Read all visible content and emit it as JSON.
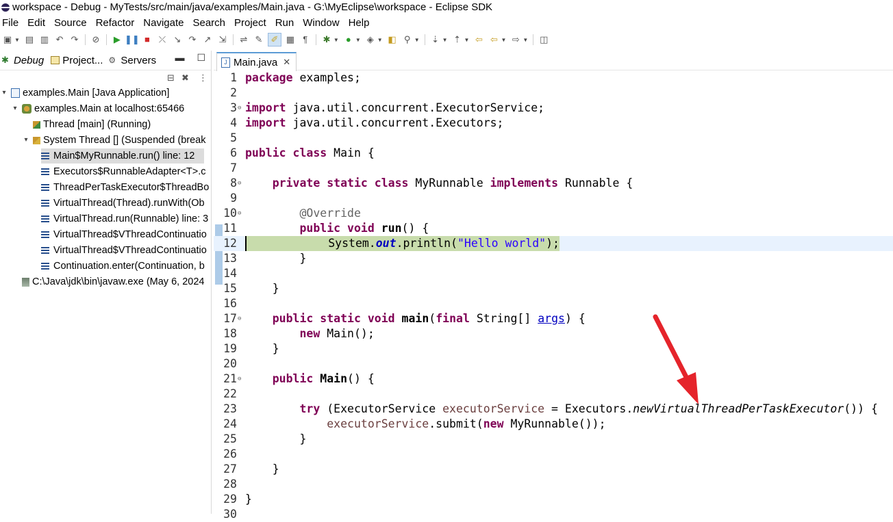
{
  "window": {
    "title": "workspace - Debug - MyTests/src/main/java/examples/Main.java - G:\\MyEclipse\\workspace - Eclipse SDK"
  },
  "menu": {
    "items": [
      "File",
      "Edit",
      "Source",
      "Refactor",
      "Navigate",
      "Search",
      "Project",
      "Run",
      "Window",
      "Help"
    ]
  },
  "toolbar": {
    "icons": [
      "new-icon",
      "save-icon",
      "save-all-icon",
      "undo-icon",
      "redo-icon",
      "skip-breakpoints-icon",
      "resume-icon",
      "suspend-icon",
      "terminate-icon",
      "disconnect-icon",
      "step-into-icon",
      "step-over-icon",
      "step-return-icon",
      "drop-to-frame-icon",
      "use-step-filters-icon",
      "toggle-mark-occurrences-icon",
      "toggle-highlight-icon",
      "block-selection-icon",
      "show-whitespace-icon",
      "debug-icon",
      "run-icon",
      "external-tools-icon",
      "open-type-icon",
      "search-icon",
      "next-annotation-icon",
      "prev-annotation-icon",
      "last-edit-icon",
      "back-icon",
      "forward-icon",
      "open-perspective-icon"
    ]
  },
  "debug_view": {
    "tabs": [
      {
        "label": "Debug",
        "active": true
      },
      {
        "label": "Project...",
        "active": false
      },
      {
        "label": "Servers",
        "active": false
      }
    ],
    "tree": [
      {
        "label": "examples.Main [Java Application]",
        "level": 0,
        "twisty": "▾",
        "icon": "java-launch-icon"
      },
      {
        "label": "examples.Main at localhost:65466",
        "level": 1,
        "twisty": "▾",
        "icon": "debug-target-icon"
      },
      {
        "label": "Thread [main] (Running)",
        "level": 2,
        "twisty": "",
        "icon": "thread-running-icon"
      },
      {
        "label": "System Thread [] (Suspended (break",
        "level": 2,
        "twisty": "▾",
        "icon": "thread-suspended-icon"
      },
      {
        "label": "Main$MyRunnable.run() line: 12",
        "level": 3,
        "twisty": "",
        "icon": "stack-frame-icon",
        "selected": true
      },
      {
        "label": "Executors$RunnableAdapter<T>.c",
        "level": 3,
        "twisty": "",
        "icon": "stack-frame-icon"
      },
      {
        "label": "ThreadPerTaskExecutor$ThreadBo",
        "level": 3,
        "twisty": "",
        "icon": "stack-frame-icon"
      },
      {
        "label": "VirtualThread(Thread).runWith(Ob",
        "level": 3,
        "twisty": "",
        "icon": "stack-frame-icon"
      },
      {
        "label": "VirtualThread.run(Runnable) line: 3",
        "level": 3,
        "twisty": "",
        "icon": "stack-frame-icon"
      },
      {
        "label": "VirtualThread$VThreadContinuatio",
        "level": 3,
        "twisty": "",
        "icon": "stack-frame-icon"
      },
      {
        "label": "VirtualThread$VThreadContinuatio",
        "level": 3,
        "twisty": "",
        "icon": "stack-frame-icon"
      },
      {
        "label": "Continuation.enter(Continuation, b",
        "level": 3,
        "twisty": "",
        "icon": "stack-frame-icon"
      },
      {
        "label": "C:\\Java\\jdk\\bin\\javaw.exe (May 6, 2024",
        "level": 1,
        "twisty": "",
        "icon": "process-icon"
      }
    ]
  },
  "editor": {
    "tab_label": "Main.java",
    "current_line": 12,
    "lines": [
      {
        "n": "1",
        "fold": "",
        "html": "<span class=\"kw\">package</span> examples;"
      },
      {
        "n": "2",
        "fold": "",
        "html": ""
      },
      {
        "n": "3",
        "fold": "⊖",
        "html": "<span class=\"kw\">import</span> java.util.concurrent.ExecutorService;"
      },
      {
        "n": "4",
        "fold": "",
        "html": "<span class=\"kw\">import</span> java.util.concurrent.Executors;"
      },
      {
        "n": "5",
        "fold": "",
        "html": ""
      },
      {
        "n": "6",
        "fold": "",
        "html": "<span class=\"kw\">public</span> <span class=\"kw\">class</span> Main {"
      },
      {
        "n": "7",
        "fold": "",
        "html": ""
      },
      {
        "n": "8",
        "fold": "⊖",
        "html": "    <span class=\"kw\">private</span> <span class=\"kw\">static</span> <span class=\"kw\">class</span> MyRunnable <span class=\"kw\">implements</span> Runnable {"
      },
      {
        "n": "9",
        "fold": "",
        "html": ""
      },
      {
        "n": "10",
        "fold": "⊖",
        "html": "        <span class=\"ann\">@Override</span>"
      },
      {
        "n": "11",
        "fold": "",
        "html": "        <span class=\"kw\">public</span> <span class=\"kw\">void</span> <b>run</b>() {"
      },
      {
        "n": "12",
        "fold": "",
        "html": "            System.<span class=\"field\">out</span>.println(<span class=\"str\">\"Hello world\"</span>);"
      },
      {
        "n": "13",
        "fold": "",
        "html": "        }"
      },
      {
        "n": "14",
        "fold": "",
        "html": ""
      },
      {
        "n": "15",
        "fold": "",
        "html": "    }"
      },
      {
        "n": "16",
        "fold": "",
        "html": ""
      },
      {
        "n": "17",
        "fold": "⊖",
        "html": "    <span class=\"kw\">public</span> <span class=\"kw\">static</span> <span class=\"kw\">void</span> <b>main</b>(<span class=\"kw\">final</span> String[] <span class=\"link\">args</span>) {"
      },
      {
        "n": "18",
        "fold": "",
        "html": "        <span class=\"kw\">new</span> Main();"
      },
      {
        "n": "19",
        "fold": "",
        "html": "    }"
      },
      {
        "n": "20",
        "fold": "",
        "html": ""
      },
      {
        "n": "21",
        "fold": "⊖",
        "html": "    <span class=\"kw\">public</span> <b>Main</b>() {"
      },
      {
        "n": "22",
        "fold": "",
        "html": ""
      },
      {
        "n": "23",
        "fold": "",
        "html": "        <span class=\"kw\">try</span> (ExecutorService <span class=\"var\">executorService</span> = Executors.<span class=\"ital\">newVirtualThreadPerTaskExecutor</span>()) {"
      },
      {
        "n": "24",
        "fold": "",
        "html": "            <span class=\"var\">executorService</span>.submit(<span class=\"kw\">new</span> MyRunnable());"
      },
      {
        "n": "25",
        "fold": "",
        "html": "        }"
      },
      {
        "n": "26",
        "fold": "",
        "html": ""
      },
      {
        "n": "27",
        "fold": "",
        "html": "    }"
      },
      {
        "n": "28",
        "fold": "",
        "html": ""
      },
      {
        "n": "29",
        "fold": "",
        "html": "}"
      },
      {
        "n": "30",
        "fold": "",
        "html": ""
      }
    ]
  },
  "annotation": {
    "arrow_color": "#e5242b"
  }
}
